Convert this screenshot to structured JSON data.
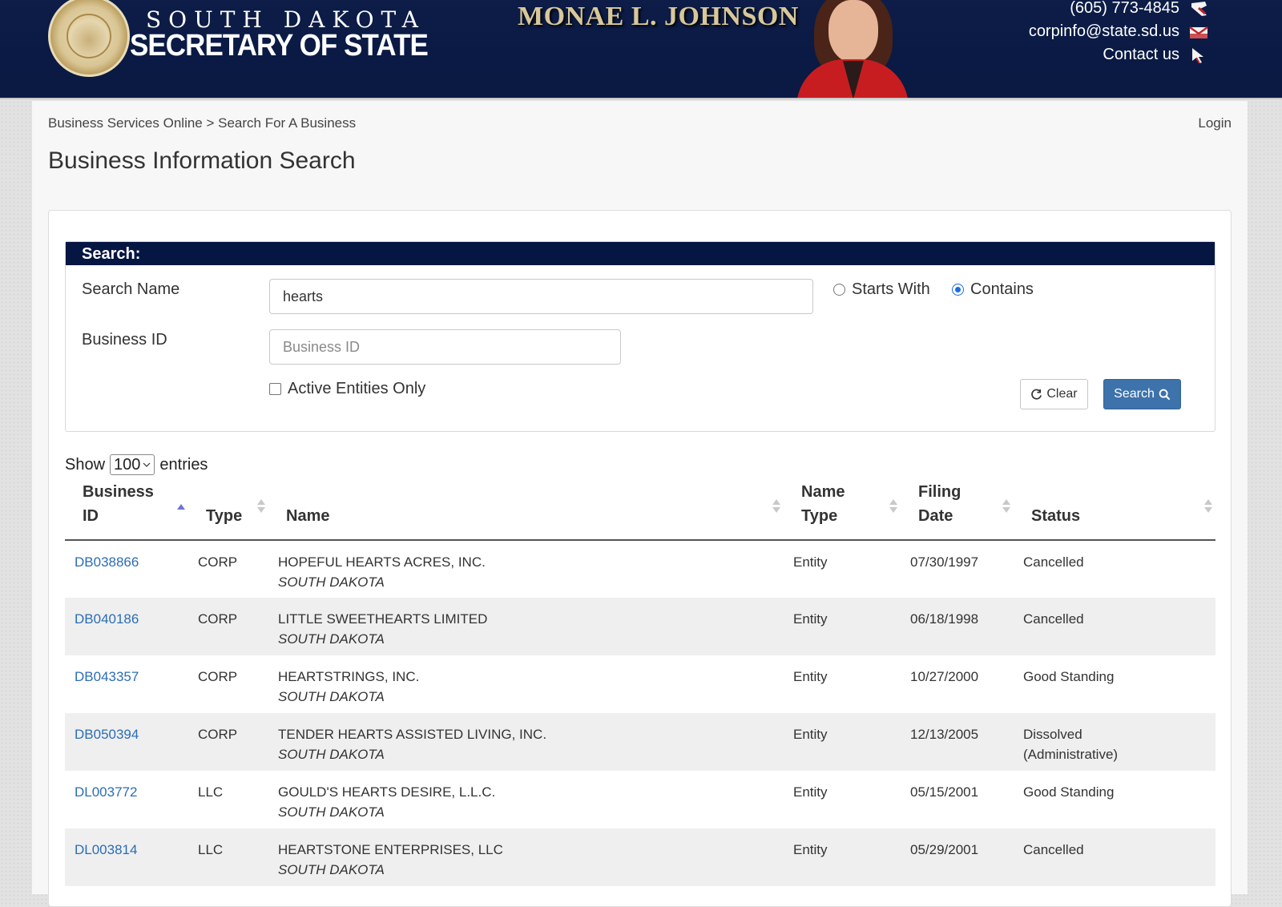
{
  "header": {
    "state_line": "SOUTH DAKOTA",
    "office_line": "SECRETARY OF STATE",
    "official_name": "MONAE L. JOHNSON",
    "phone": "(605) 773-4845",
    "email": "corpinfo@state.sd.us",
    "contact_link": "Contact us",
    "seal_text": "STATE OF SOUTH DAKOTA"
  },
  "breadcrumb": "Business Services Online > Search For A Business",
  "login_label": "Login",
  "page_title": "Business Information Search",
  "search": {
    "section_title": "Search:",
    "name_label": "Search Name",
    "name_value": "hearts",
    "id_label": "Business ID",
    "id_placeholder": "Business ID",
    "option_starts_with": "Starts With",
    "option_contains": "Contains",
    "selected_option": "contains",
    "active_only_label": "Active Entities Only",
    "active_only_checked": false,
    "clear_label": "Clear",
    "search_label": "Search"
  },
  "entries": {
    "show_label": "Show",
    "count": "100",
    "suffix": "entries"
  },
  "table": {
    "headers": {
      "business_id_1": "Business",
      "business_id_2": "ID",
      "type": "Type",
      "name": "Name",
      "name_type_1": "Name",
      "name_type_2": "Type",
      "filing_date_1": "Filing",
      "filing_date_2": "Date",
      "status": "Status"
    },
    "rows": [
      {
        "id": "DB038866",
        "type": "CORP",
        "name": "HOPEFUL HEARTS ACRES, INC.",
        "state": "SOUTH DAKOTA",
        "name_type": "Entity",
        "filing_date": "07/30/1997",
        "status": "Cancelled",
        "status_2": ""
      },
      {
        "id": "DB040186",
        "type": "CORP",
        "name": "LITTLE SWEETHEARTS LIMITED",
        "state": "SOUTH DAKOTA",
        "name_type": "Entity",
        "filing_date": "06/18/1998",
        "status": "Cancelled",
        "status_2": ""
      },
      {
        "id": "DB043357",
        "type": "CORP",
        "name": "HEARTSTRINGS, INC.",
        "state": "SOUTH DAKOTA",
        "name_type": "Entity",
        "filing_date": "10/27/2000",
        "status": "Good Standing",
        "status_2": ""
      },
      {
        "id": "DB050394",
        "type": "CORP",
        "name": "TENDER HEARTS ASSISTED LIVING, INC.",
        "state": "SOUTH DAKOTA",
        "name_type": "Entity",
        "filing_date": "12/13/2005",
        "status": "Dissolved",
        "status_2": "(Administrative)"
      },
      {
        "id": "DL003772",
        "type": "LLC",
        "name": "GOULD'S HEARTS DESIRE, L.L.C.",
        "state": "SOUTH DAKOTA",
        "name_type": "Entity",
        "filing_date": "05/15/2001",
        "status": "Good Standing",
        "status_2": ""
      },
      {
        "id": "DL003814",
        "type": "LLC",
        "name": "HEARTSTONE ENTERPRISES, LLC",
        "state": "SOUTH DAKOTA",
        "name_type": "Entity",
        "filing_date": "05/29/2001",
        "status": "Cancelled",
        "status_2": ""
      }
    ]
  },
  "colors": {
    "header_navy": "#0a1a44",
    "search_bar_navy": "#061642",
    "link_blue": "#2b6db5",
    "search_button": "#3d72aa",
    "official_gold": "#d8c79a"
  }
}
